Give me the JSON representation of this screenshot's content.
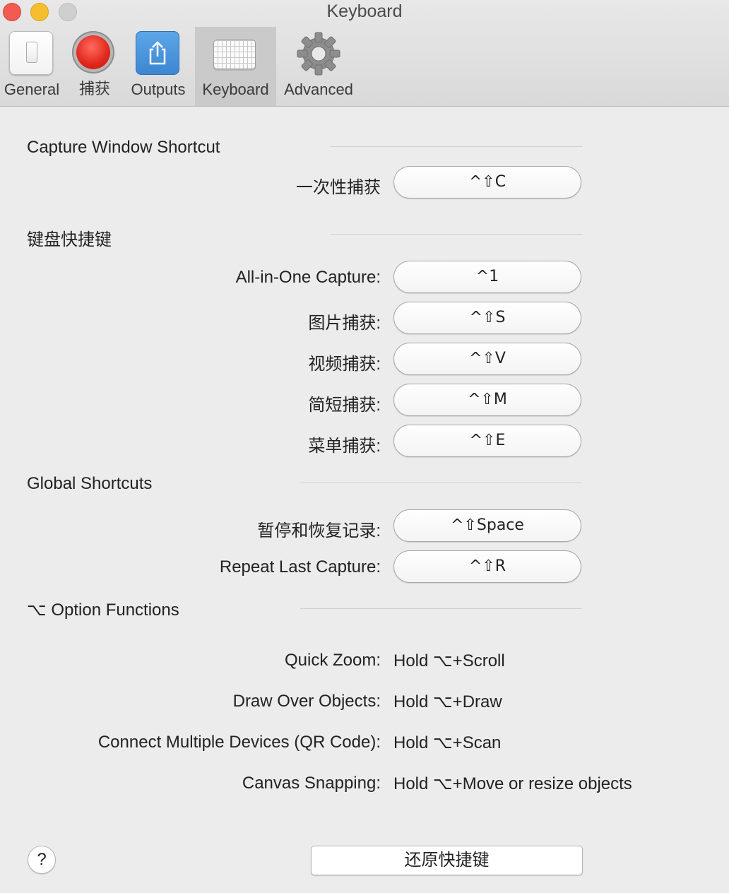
{
  "window": {
    "title": "Keyboard"
  },
  "toolbar": {
    "tabs": [
      {
        "label": "General",
        "icon": "general-switch-icon"
      },
      {
        "label": "捕获",
        "icon": "record-icon"
      },
      {
        "label": "Outputs",
        "icon": "share-icon"
      },
      {
        "label": "Keyboard",
        "icon": "keyboard-icon",
        "selected": true
      },
      {
        "label": "Advanced",
        "icon": "gear-icon"
      }
    ]
  },
  "capture_window": {
    "title": "Capture Window Shortcut",
    "rows": [
      {
        "label": "一次性捕获",
        "shortcut": "^⇧C"
      }
    ]
  },
  "keyboard_shortcuts": {
    "title": "键盘快捷键",
    "rows": [
      {
        "label": "All-in-One Capture:",
        "shortcut": "^1"
      },
      {
        "label": "图片捕获:",
        "shortcut": "^⇧S"
      },
      {
        "label": "视频捕获:",
        "shortcut": "^⇧V"
      },
      {
        "label": "简短捕获:",
        "shortcut": "^⇧M"
      },
      {
        "label": "菜单捕获:",
        "shortcut": "^⇧E"
      }
    ]
  },
  "global_shortcuts": {
    "title": "Global Shortcuts",
    "rows": [
      {
        "label": "暂停和恢复记录:",
        "shortcut": "^⇧Space"
      },
      {
        "label": "Repeat Last Capture:",
        "shortcut": "^⇧R"
      }
    ]
  },
  "option_functions": {
    "title": "⌥ Option Functions",
    "rows": [
      {
        "label": "Quick Zoom:",
        "value": "Hold ⌥+Scroll"
      },
      {
        "label": "Draw Over Objects:",
        "value": "Hold ⌥+Draw"
      },
      {
        "label": "Connect Multiple Devices (QR Code):",
        "value": "Hold ⌥+Scan"
      },
      {
        "label": "Canvas Snapping:",
        "value": "Hold ⌥+Move or resize objects"
      }
    ]
  },
  "footer": {
    "help_label": "?",
    "reset_label": "还原快捷键"
  }
}
